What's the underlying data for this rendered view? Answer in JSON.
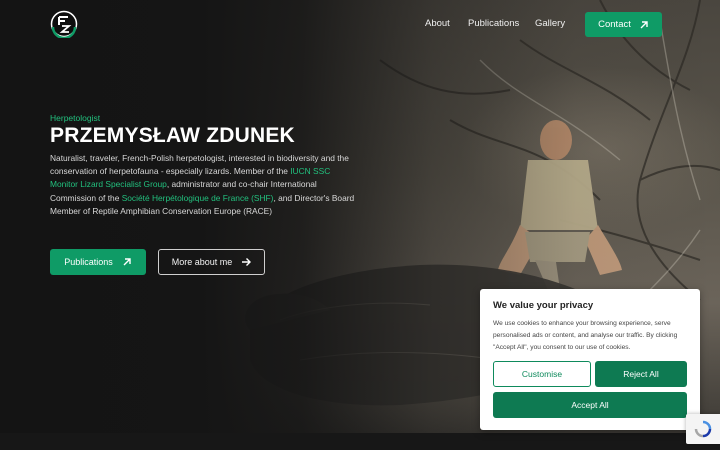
{
  "header": {
    "nav": [
      {
        "label": "About"
      },
      {
        "label": "Publications"
      },
      {
        "label": "Gallery"
      }
    ],
    "contact_label": "Contact"
  },
  "hero": {
    "eyebrow": "Herpetologist",
    "title": "PRZEMYSŁAW ZDUNEK",
    "bio": {
      "t1": "Naturalist, traveler, French-Polish herpetologist, interested in biodiversity and the conservation of herpetofauna - especially lizards. Member of the ",
      "link1": "IUCN SSC Monitor Lizard Specialist Group",
      "t2": ", administrator and co-chair International Commission of the ",
      "link2": "Société Herpétologique de France (SHF)",
      "t3": ", and Director's Board Member of Reptile Amphibian Conservation Europe (RACE)"
    },
    "btn_publications": "Publications",
    "btn_more": "More about me"
  },
  "cookie": {
    "title": "We value your privacy",
    "text": "We use cookies to enhance your browsing experience, serve personalised ads or content, and analyse our traffic. By clicking \"Accept All\", you consent to our use of cookies.",
    "customise": "Customise",
    "reject": "Reject All",
    "accept": "Accept All"
  },
  "colors": {
    "accent": "#0f9b66",
    "accent_text": "#22c07e",
    "background": "#141414"
  },
  "icons": [
    "logo-icon",
    "arrow-up-right-icon",
    "arrow-right-icon",
    "recaptcha-icon"
  ]
}
